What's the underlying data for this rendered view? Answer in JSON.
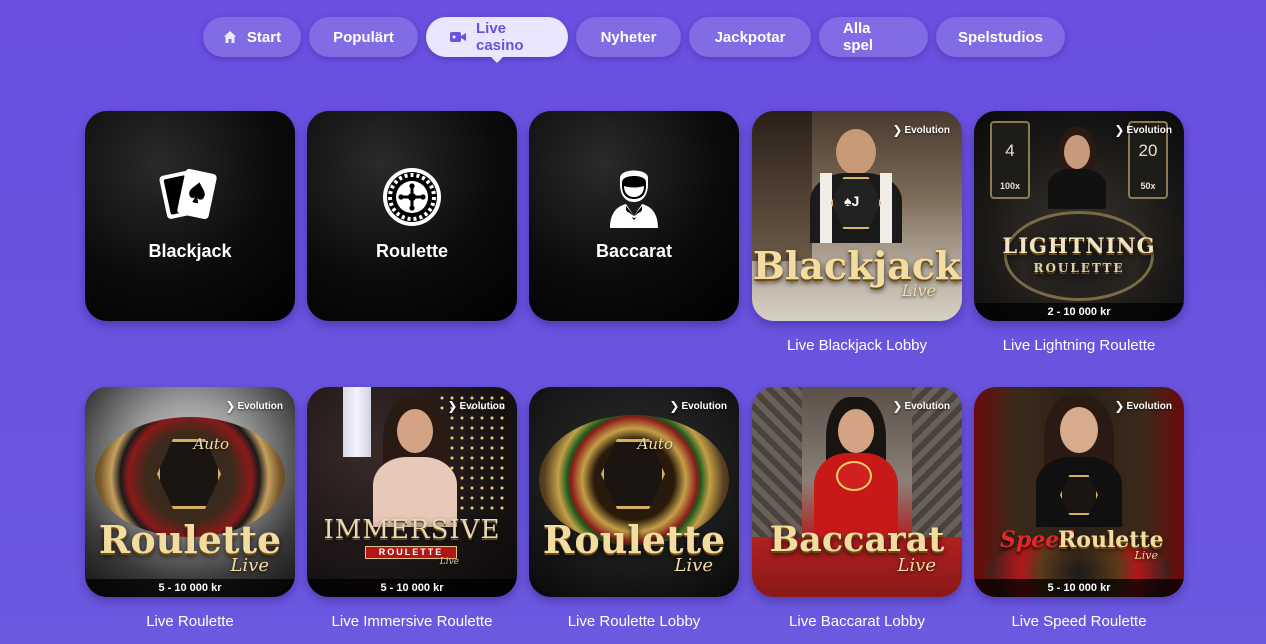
{
  "nav": {
    "items": [
      {
        "label": "Start",
        "icon": "home-icon"
      },
      {
        "label": "Populärt"
      },
      {
        "label": "Live casino",
        "icon": "video-camera-icon",
        "active": true
      },
      {
        "label": "Nyheter"
      },
      {
        "label": "Jackpotar"
      },
      {
        "label": "Alla spel"
      },
      {
        "label": "Spelstudios"
      }
    ]
  },
  "categories": [
    {
      "label": "Blackjack",
      "icon": "playing-cards-icon"
    },
    {
      "label": "Roulette",
      "icon": "roulette-wheel-icon"
    },
    {
      "label": "Baccarat",
      "icon": "dealer-icon"
    }
  ],
  "provider": "Evolution",
  "games": [
    {
      "name": "Live Blackjack Lobby",
      "art_title": "Blackjack",
      "art_sub": "Live"
    },
    {
      "name": "Live Lightning Roulette",
      "art_title": "LIGHTNING",
      "art_sub": "ROULETTE",
      "limits": "2 - 10 000 kr",
      "left_num": "4",
      "left_mult": "100x",
      "right_num": "20",
      "right_mult": "50x"
    },
    {
      "name": "Live Roulette",
      "art_title": "Roulette",
      "art_sub": "Live",
      "art_top": "Auto",
      "limits": "5 - 10 000 kr"
    },
    {
      "name": "Live Immersive Roulette",
      "art_title": "IMMERSIVE",
      "art_sub": "ROULETTE",
      "art_sub2": "Live",
      "limits": "5 - 10 000 kr"
    },
    {
      "name": "Live Roulette Lobby",
      "art_title": "Roulette",
      "art_sub": "Live",
      "art_top": "Auto"
    },
    {
      "name": "Live Baccarat Lobby",
      "art_title": "Baccarat",
      "art_sub": "Live"
    },
    {
      "name": "Live Speed Roulette",
      "art_title": "Roulette",
      "art_prefix": "Speed",
      "art_sub": "Live",
      "limits": "5 - 10 000 kr"
    }
  ],
  "colors": {
    "background": "#6a4fe0",
    "active_pill": "#ebe6ff",
    "gold_text": "#f2dca0"
  }
}
